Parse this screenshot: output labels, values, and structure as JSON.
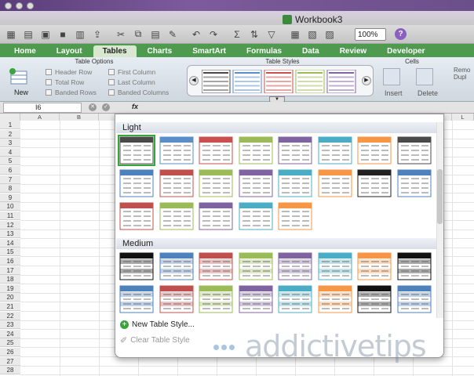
{
  "window": {
    "title": "Workbook3"
  },
  "toolbar": {
    "zoom": "100%",
    "help": "?"
  },
  "tabs": [
    {
      "label": "Home"
    },
    {
      "label": "Layout"
    },
    {
      "label": "Tables"
    },
    {
      "label": "Charts"
    },
    {
      "label": "SmartArt"
    },
    {
      "label": "Formulas"
    },
    {
      "label": "Data"
    },
    {
      "label": "Review"
    },
    {
      "label": "Developer"
    }
  ],
  "ribbon": {
    "groups": {
      "table_options": "Table Options",
      "table_styles": "Table Styles",
      "cells": "Cells"
    },
    "new_label": "New",
    "options": [
      "Header Row",
      "Total Row",
      "Banded Rows",
      "First Column",
      "Last Column",
      "Banded Columns"
    ],
    "cells": {
      "insert": "Insert",
      "delete": "Delete",
      "remove": "Remo",
      "duplicate": "Dupl"
    }
  },
  "formula": {
    "cell": "I6",
    "fx": "fx"
  },
  "columns": [
    "A",
    "B",
    "C",
    "D",
    "E",
    "F",
    "G",
    "H",
    "I",
    "J",
    "K",
    "L"
  ],
  "rows": [
    "1",
    "2",
    "3",
    "4",
    "5",
    "6",
    "7",
    "8",
    "9",
    "10",
    "11",
    "12",
    "13",
    "14",
    "15",
    "16",
    "17",
    "18",
    "19",
    "20",
    "21",
    "22",
    "23",
    "24",
    "25",
    "26",
    "27",
    "28"
  ],
  "gallery": {
    "section_light": "Light",
    "section_medium": "Medium",
    "new_style": "New Table Style...",
    "clear_style": "Clear Table Style",
    "light_colors": [
      "#4a4a4a",
      "#5b8dc9",
      "#c9504e",
      "#9bbb59",
      "#8064a2",
      "#4bacc6",
      "#f79646",
      "#4a4a4a",
      "#4f81bd",
      "#c0504d",
      "#9bbb59",
      "#8064a2",
      "#4bacc6",
      "#f79646",
      "#222222",
      "#4f81bd",
      "#c0504d",
      "#9bbb59",
      "#8064a2",
      "#4bacc6",
      "#f79646"
    ],
    "medium_colors": [
      "#111111",
      "#4f81bd",
      "#c0504d",
      "#9bbb59",
      "#8064a2",
      "#4bacc6",
      "#f79646",
      "#111111",
      "#4f81bd",
      "#c0504d",
      "#9bbb59",
      "#8064a2",
      "#4bacc6",
      "#f79646",
      "#111111",
      "#4f81bd"
    ]
  },
  "watermark": "addictivetips"
}
